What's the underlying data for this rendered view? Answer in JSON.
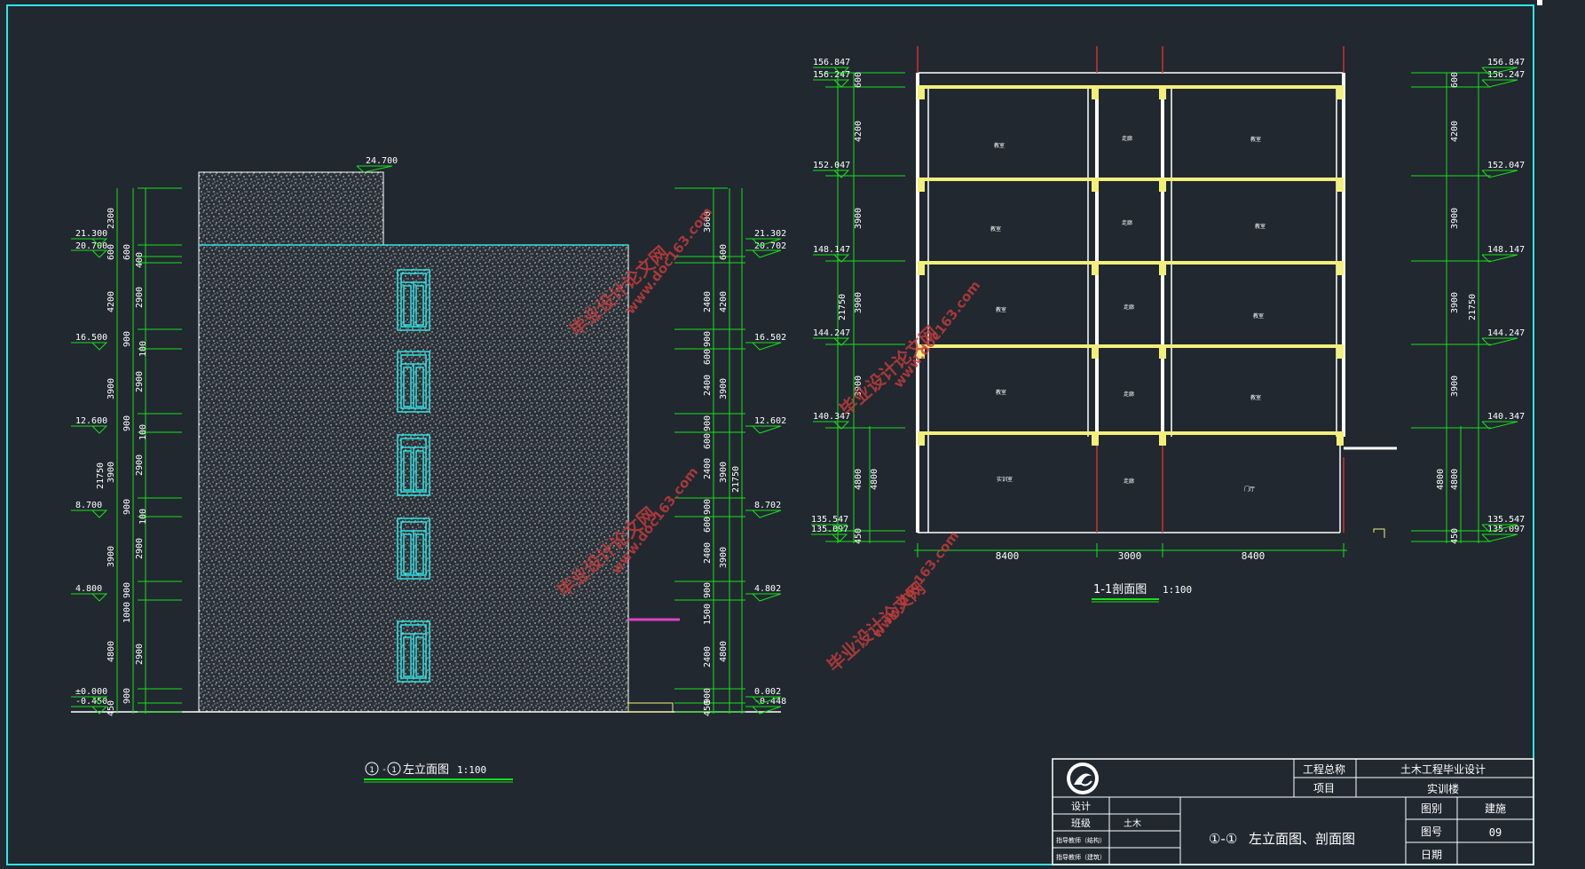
{
  "elevation": {
    "title": "左立面图",
    "axis_from": "1",
    "axis_to": "1",
    "scale": "1:100",
    "roof_level": "24.700",
    "levels_left": [
      "21.300",
      "20.700",
      "16.500",
      "12.600",
      "8.700",
      "4.800",
      "±0.000",
      "-0.450"
    ],
    "levels_right": [
      "21.302",
      "20.702",
      "16.502",
      "12.602",
      "8.702",
      "4.802",
      "0.002",
      "-0.448"
    ],
    "dims_left_outer": [
      "2300",
      "600",
      "4200",
      "3900",
      "21750",
      "3900",
      "3900",
      "4800",
      "450"
    ],
    "dims_left_inner": [
      "600",
      "400",
      "2900",
      "900",
      "100",
      "2900",
      "900",
      "100",
      "2900",
      "900",
      "100",
      "2900",
      "900",
      "1000",
      "2900",
      "900"
    ],
    "dims_right_a": [
      "3600",
      "2400",
      "900",
      "600",
      "2400",
      "900",
      "600",
      "2400",
      "900",
      "600",
      "2400",
      "900",
      "1500",
      "2400",
      "900",
      "450"
    ],
    "dims_right_b": [
      "600",
      "4200",
      "3900",
      "3900",
      "21750",
      "3900",
      "4800"
    ]
  },
  "section": {
    "title": "1-1剖面图",
    "scale": "1:100",
    "levels": [
      "156.847",
      "156.247",
      "152.047",
      "148.147",
      "144.247",
      "140.347",
      "135.547",
      "135.097"
    ],
    "dims_vertical": [
      "600",
      "4200",
      "3900",
      "3900",
      "3900",
      "4800",
      "450"
    ],
    "total_height": "21750",
    "spans": [
      "8400",
      "3000",
      "8400"
    ],
    "room_labels": [
      "教室",
      "走廊",
      "教室",
      "教室",
      "走廊",
      "教室",
      "教室",
      "走廊",
      "教室",
      "教室",
      "走廊",
      "教室",
      "实训室",
      "走廊",
      "门厅"
    ]
  },
  "watermark": {
    "text": "毕业设计论文网",
    "url": "www.doc163.com"
  },
  "title_block": {
    "project_label": "工程总称",
    "project_value": "土木工程毕业设计",
    "item_label": "项目",
    "item_value": "实训楼",
    "design_label": "设计",
    "class_label": "班级",
    "class_value": "土木",
    "advisor_label_1": "指导教师（结构）",
    "advisor_label_2": "指导教师（建筑）",
    "drawing_title_prefix": "①-①",
    "drawing_title": "左立面图、剖面图",
    "category_label": "图别",
    "category_value": "建施",
    "number_label": "图号",
    "number_value": "09",
    "date_label": "日期",
    "date_value": ""
  },
  "colors": {
    "background": "#212830",
    "frame": "#2ee6e6",
    "dimension": "#18e018",
    "wall": "#ffffff",
    "slab": "#f2f07a",
    "window": "#2ee6e6",
    "title_underline": "#18e018"
  }
}
